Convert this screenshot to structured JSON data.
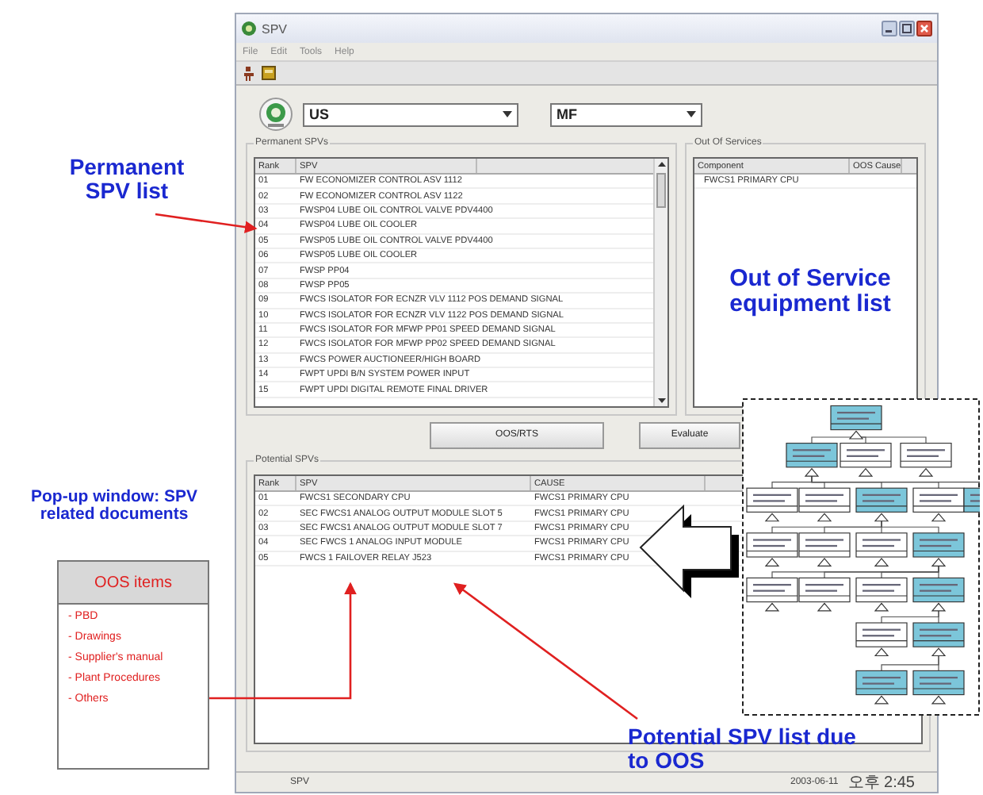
{
  "window": {
    "title": "SPV",
    "menu": [
      "File",
      "Edit",
      "Tools",
      "Help"
    ]
  },
  "selectors": [
    {
      "value": "US"
    },
    {
      "value": "MF"
    }
  ],
  "permanent_spvs": {
    "title": "Permanent SPVs",
    "columns": [
      "Rank",
      "SPV"
    ],
    "rows": [
      [
        "01",
        "FW ECONOMIZER CONTROL ASV 1112"
      ],
      [
        "02",
        "FW ECONOMIZER CONTROL ASV 1122"
      ],
      [
        "03",
        "FWSP04 LUBE OIL CONTROL VALVE PDV4400"
      ],
      [
        "04",
        "FWSP04 LUBE OIL COOLER"
      ],
      [
        "05",
        "FWSP05 LUBE OIL CONTROL VALVE PDV4400"
      ],
      [
        "06",
        "FWSP05 LUBE OIL COOLER"
      ],
      [
        "07",
        "FWSP PP04"
      ],
      [
        "08",
        "FWSP PP05"
      ],
      [
        "09",
        "FWCS ISOLATOR FOR ECNZR VLV 1112 POS DEMAND SIGNAL"
      ],
      [
        "10",
        "FWCS ISOLATOR FOR ECNZR VLV 1122 POS DEMAND SIGNAL"
      ],
      [
        "11",
        "FWCS ISOLATOR FOR MFWP PP01 SPEED DEMAND SIGNAL"
      ],
      [
        "12",
        "FWCS ISOLATOR FOR MFWP PP02 SPEED DEMAND SIGNAL"
      ],
      [
        "13",
        "FWCS POWER AUCTIONEER/HIGH BOARD"
      ],
      [
        "14",
        "FWPT UPDI B/N SYSTEM POWER INPUT"
      ],
      [
        "15",
        "FWPT UPDI DIGITAL REMOTE FINAL DRIVER"
      ]
    ]
  },
  "out_of_services": {
    "title": "Out Of Services",
    "columns": [
      "Component",
      "OOS Cause"
    ],
    "rows": [
      {
        "component": "FWCS1 PRIMARY CPU"
      }
    ]
  },
  "buttons": [
    "OOS/RTS",
    "Evaluate"
  ],
  "potential_spvs": {
    "title": "Potential SPVs",
    "columns": [
      "Rank",
      "SPV",
      "CAUSE"
    ],
    "rows": [
      [
        "01",
        "FWCS1 SECONDARY CPU",
        "FWCS1 PRIMARY CPU"
      ],
      [
        "02",
        "SEC FWCS1 ANALOG OUTPUT MODULE SLOT 5",
        "FWCS1 PRIMARY CPU"
      ],
      [
        "03",
        "SEC FWCS1 ANALOG OUTPUT MODULE SLOT 7",
        "FWCS1 PRIMARY CPU"
      ],
      [
        "04",
        "SEC FWCS 1 ANALOG INPUT MODULE",
        "FWCS1 PRIMARY CPU"
      ],
      [
        "05",
        "FWCS 1 FAILOVER RELAY J523",
        "FWCS1 PRIMARY CPU"
      ]
    ]
  },
  "status_bar": [
    "SPV",
    "2003-06-11",
    "오후 2:45"
  ],
  "annotations": [
    {
      "kind": "callout",
      "text": "Permanent SPV list"
    },
    {
      "kind": "callout",
      "text": "Out of Service equipment list"
    },
    {
      "kind": "callout",
      "text": "Pop-up window: SPV related documents"
    },
    {
      "kind": "callout",
      "text": "Potential SPV list due to OOS"
    }
  ],
  "popup": {
    "title": "OOS items",
    "items": [
      "- PBD",
      "- Drawings",
      "- Supplier's manual",
      "- Plant Procedures",
      "- Others"
    ]
  }
}
